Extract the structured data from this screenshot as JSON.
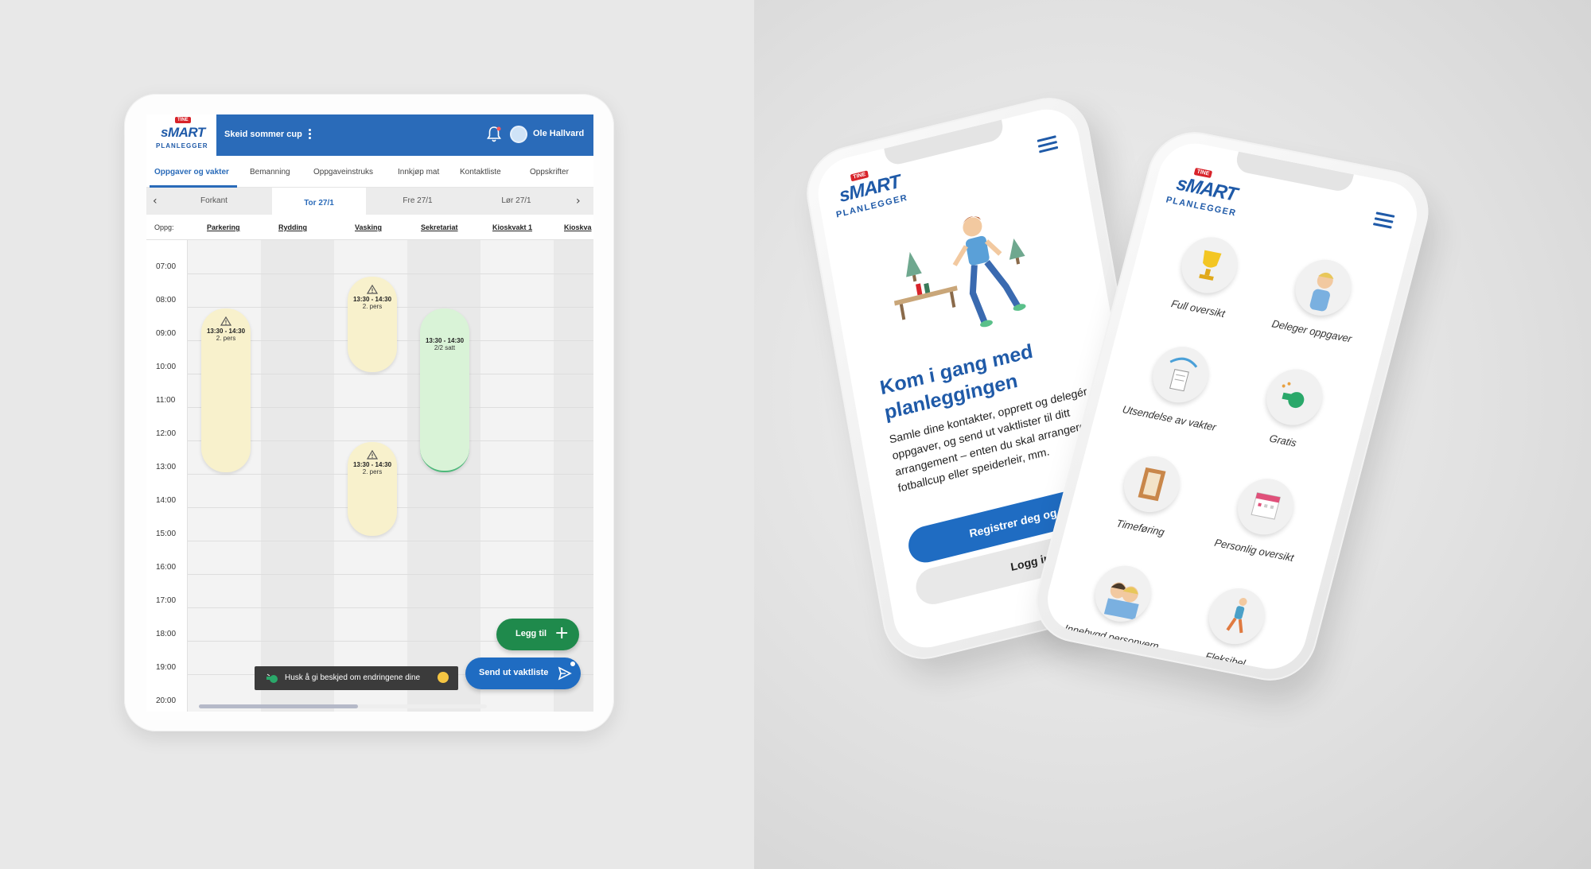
{
  "tablet": {
    "brand": {
      "tine": "TINE",
      "smart": "sMART",
      "planlegger": "PLANLEGGER"
    },
    "event_name": "Skeid sommer cup",
    "user_name": "Ole Hallvard",
    "nav_tabs": [
      {
        "label": "Oppgaver og vakter"
      },
      {
        "label": "Bemanning"
      },
      {
        "label": "Oppgaveinstruks"
      },
      {
        "label": "Innkjøp mat"
      },
      {
        "label": "Kontaktliste"
      },
      {
        "label": "Oppskrifter"
      }
    ],
    "days": [
      {
        "label": "Forkant"
      },
      {
        "label": "Tor 27/1"
      },
      {
        "label": "Fre 27/1"
      },
      {
        "label": "Lør 27/1"
      }
    ],
    "task_header_label": "Oppg:",
    "tasks": [
      {
        "label": "Parkering"
      },
      {
        "label": "Rydding"
      },
      {
        "label": "Vasking"
      },
      {
        "label": "Sekretariat"
      },
      {
        "label": "Kioskvakt 1"
      },
      {
        "label": "Kioskva"
      }
    ],
    "times": [
      "07:00",
      "08:00",
      "09:00",
      "10:00",
      "11:00",
      "12:00",
      "13:00",
      "14:00",
      "15:00",
      "16:00",
      "17:00",
      "18:00",
      "19:00",
      "20:00"
    ],
    "shifts": [
      {
        "time": "13:30 - 14:30",
        "info": "2. pers",
        "status": "warning"
      },
      {
        "time": "13:30 - 14:30",
        "info": "2. pers",
        "status": "warning"
      },
      {
        "time": "13:30 - 14:30",
        "info": "2. pers",
        "status": "warning"
      },
      {
        "time": "13:30 - 14:30",
        "info": "2/2 satt",
        "status": "complete"
      }
    ],
    "add_button_label": "Legg til",
    "send_button_label": "Send ut vaktliste",
    "toast_text": "Husk å gi beskjed om endringene dine",
    "colors": {
      "primary": "#2a6bb9",
      "green": "#1f8a4c",
      "warning_fill": "#f8f1cc",
      "complete_fill": "#d9f3d7"
    }
  },
  "phone_landing": {
    "brand": {
      "tine": "TINE",
      "smart": "sMART",
      "planlegger": "PLANLEGGER"
    },
    "title": "Kom i gang med planleggingen",
    "body": "Samle dine kontakter, opprett og delegér oppgaver, og send ut vaktlister til ditt arrangement – enten du skal arrangere fotballcup eller speiderleir, mm.",
    "register_button": "Registrer deg og prøv",
    "login_button": "Logg inn"
  },
  "phone_features": {
    "brand": {
      "tine": "TINE",
      "smart": "sMART",
      "planlegger": "PLANLEGGER"
    },
    "features": [
      {
        "label": "Full oversikt",
        "icon": "trophy-icon"
      },
      {
        "label": "Deleger oppgaver",
        "icon": "person-icon"
      },
      {
        "label": "Utsendelse av vakter",
        "icon": "paper-plane-icon"
      },
      {
        "label": "Gratis",
        "icon": "whistle-icon"
      },
      {
        "label": "Timeføring",
        "icon": "frame-icon"
      },
      {
        "label": "Personlig oversikt",
        "icon": "calendar-icon"
      },
      {
        "label": "Innebygd personvern",
        "icon": "people-icon"
      },
      {
        "label": "Fleksibel",
        "icon": "runner-icon"
      }
    ]
  }
}
